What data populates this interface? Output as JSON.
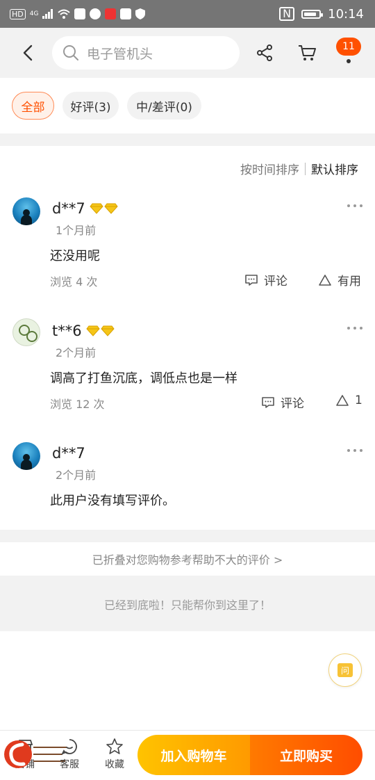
{
  "status_bar": {
    "left_label": "HD",
    "signal_label": "4G",
    "time": "10:14",
    "nfc_label": "N",
    "battery_level": 0.85
  },
  "header": {
    "search_placeholder": "电子管机头",
    "cart_count": "11"
  },
  "filters": [
    {
      "label": "全部",
      "active": true
    },
    {
      "label": "好评(3)",
      "active": false
    },
    {
      "label": "中/差评(0)",
      "active": false
    }
  ],
  "sort": {
    "by_time": "按时间排序",
    "default": "默认排序"
  },
  "reviews": [
    {
      "user": "d**7",
      "time": "1个月前",
      "text": "还没用呢",
      "views": "浏览 4 次",
      "comment_label": "评论",
      "useful_label": "有用",
      "avatar": "blue",
      "gems": 2
    },
    {
      "user": "t**6",
      "time": "2个月前",
      "text": "调高了打鱼沉底，调低点也是一样",
      "views": "浏览 12 次",
      "comment_label": "评论",
      "useful_label": "1",
      "avatar": "green",
      "gems": 2
    },
    {
      "user": "d**7",
      "time": "2个月前",
      "text": "此用户没有填写评价。",
      "avatar": "blue",
      "gems": 0
    }
  ],
  "folded_text": "已折叠对您购物参考帮助不大的评价 >",
  "end_text": "已经到底啦！只能帮你到这里了！",
  "float_qa_label": "问",
  "bottom_bar": {
    "shop_label": "店铺",
    "service_label": "客服",
    "favorite_label": "收藏",
    "add_cart": "加入购物车",
    "buy_now": "立即购买"
  },
  "colors": {
    "accent": "#ff5000",
    "gem": "#f5c518",
    "add_cart_from": "#ffc300",
    "buy_now_to": "#ff4d00"
  }
}
